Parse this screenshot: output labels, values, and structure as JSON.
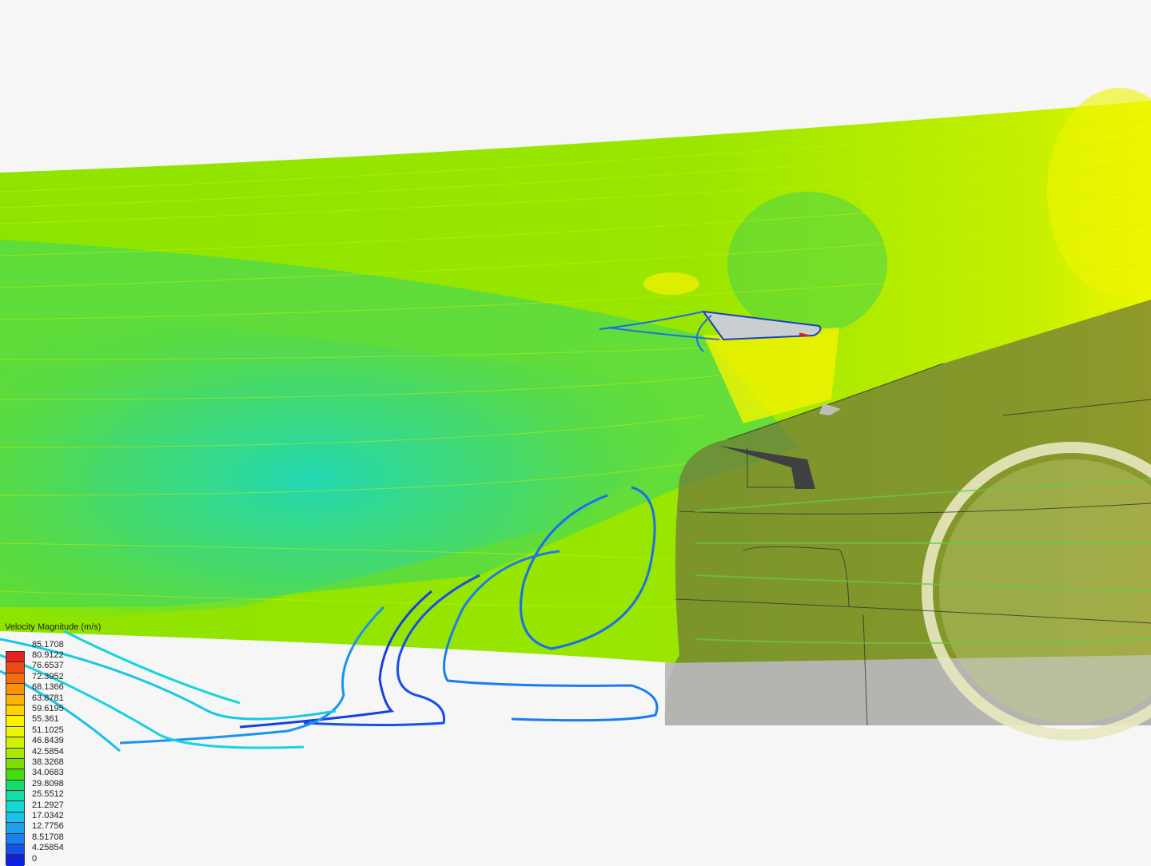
{
  "legend": {
    "title": "Velocity Magnitude (m/s)",
    "ticks": [
      "85.1708",
      "80.9122",
      "76.6537",
      "72.3952",
      "68.1366",
      "63.8781",
      "59.6195",
      "55.361",
      "51.1025",
      "46.8439",
      "42.5854",
      "38.3268",
      "34.0683",
      "29.8098",
      "25.5512",
      "21.2927",
      "17.0342",
      "12.7756",
      "8.51708",
      "4.25854",
      "0"
    ],
    "colors": [
      "#e82020",
      "#ee4a14",
      "#f36f0c",
      "#f99206",
      "#fdb400",
      "#ffd200",
      "#fff000",
      "#eef700",
      "#cff200",
      "#a7ea00",
      "#7ee000",
      "#47dc10",
      "#13dc70",
      "#0de0a8",
      "#14d8d4",
      "#18c2ec",
      "#1aa2ee",
      "#1a7ef0",
      "#1652e8",
      "#0e22e0"
    ]
  }
}
